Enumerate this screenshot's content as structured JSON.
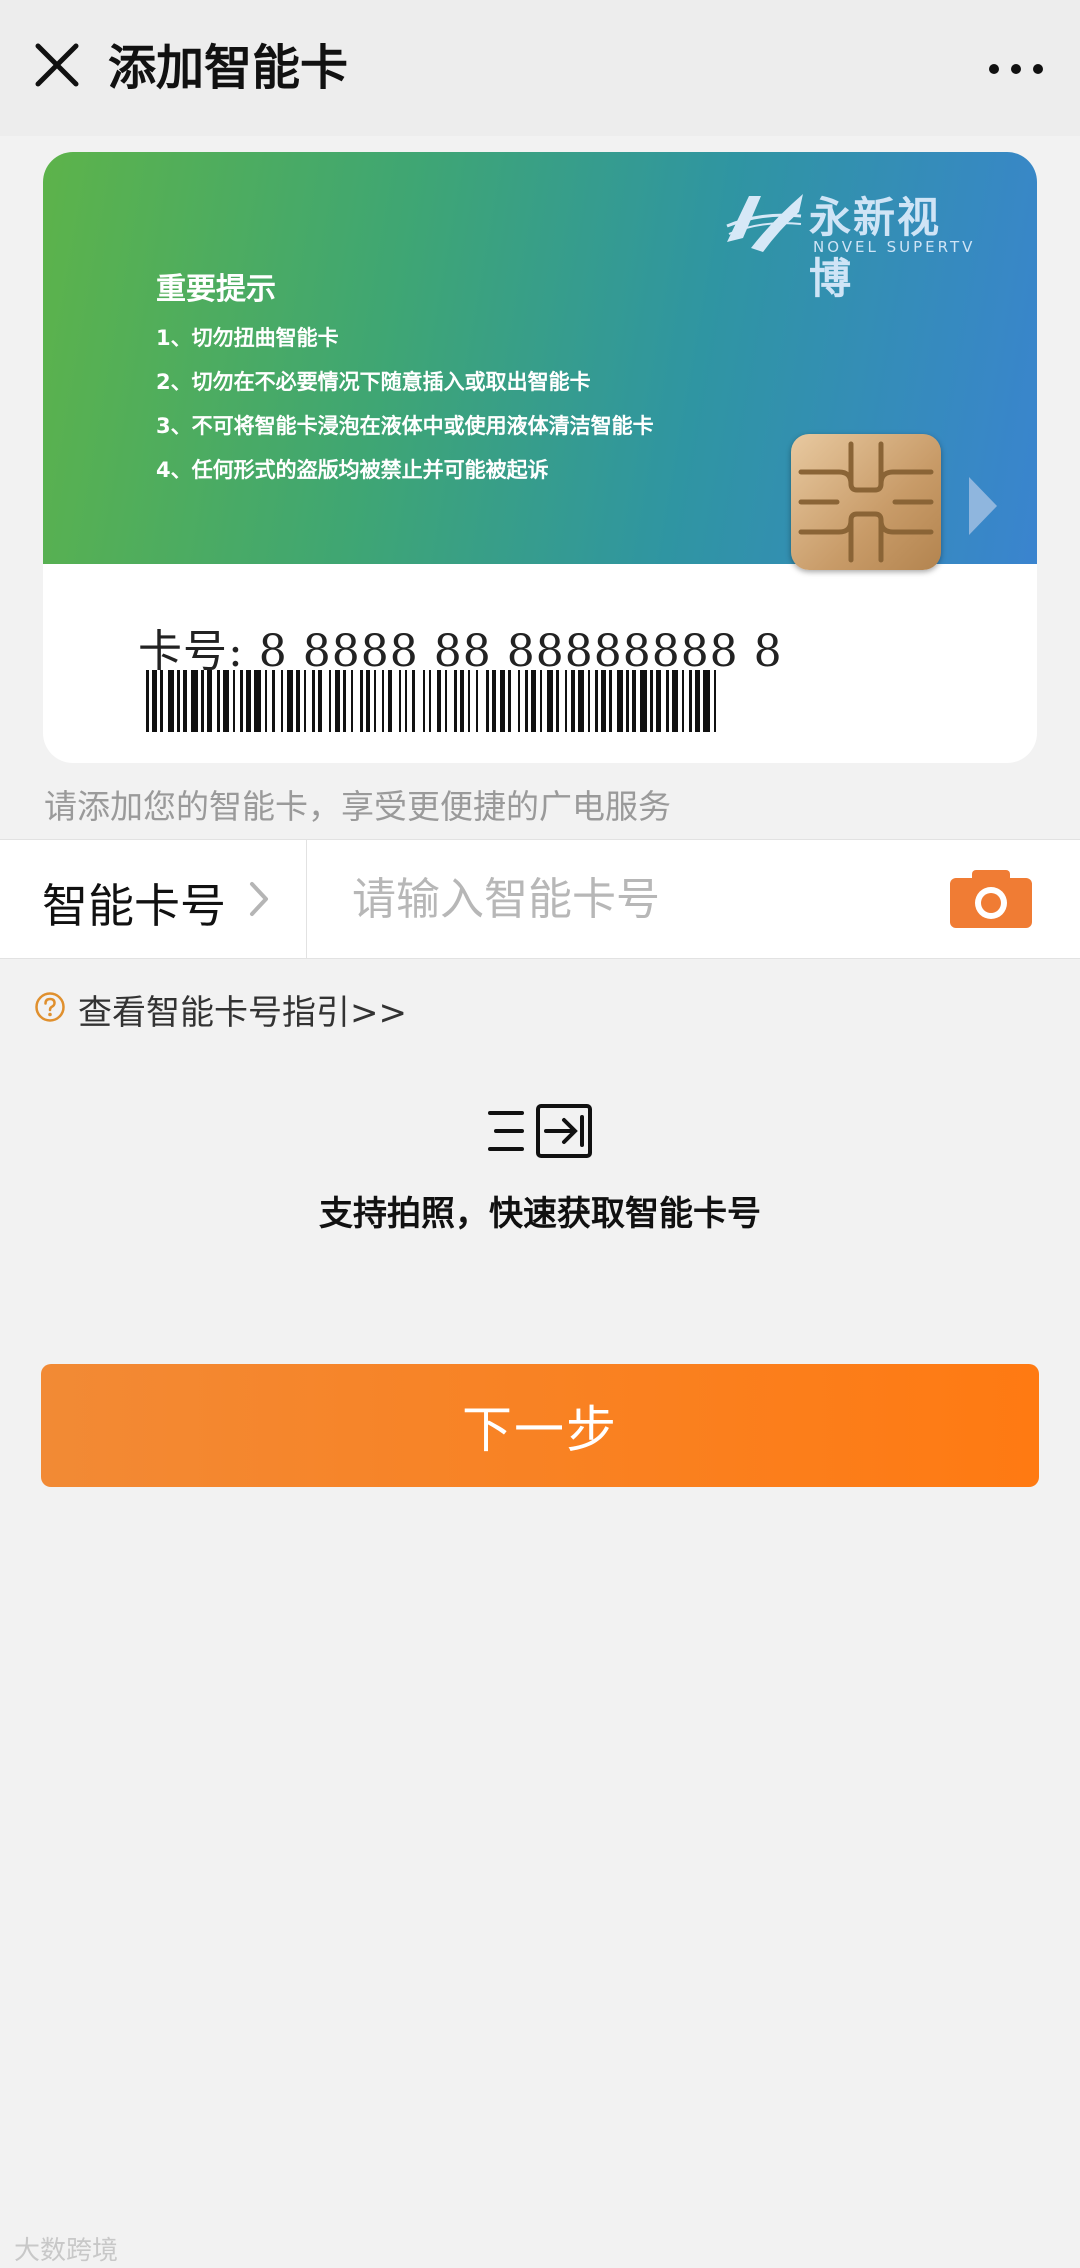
{
  "header": {
    "title": "添加智能卡",
    "close_icon": "close-icon",
    "more_icon": "more-dots-icon"
  },
  "card": {
    "brand_cn": "永新视博",
    "brand_en": "NOVEL SUPERTV",
    "notice_title": "重要提示",
    "notices": [
      "1、切勿扭曲智能卡",
      "2、切勿在不必要情况下随意插入或取出智能卡",
      "3、不可将智能卡浸泡在液体中或使用液体清洁智能卡",
      "4、任何形式的盗版均被禁止并可能被起诉"
    ],
    "number_text": "卡号: 8  8888 88  88888888 8"
  },
  "hint": "请添加您的智能卡，享受更便捷的广电服务",
  "input_row": {
    "label": "智能卡号",
    "placeholder": "请输入智能卡号",
    "value": "",
    "camera_icon": "camera-icon"
  },
  "guide": {
    "text": "查看智能卡号指引>>",
    "icon": "question-circle-icon"
  },
  "scan": {
    "icon": "scan-input-icon",
    "caption": "支持拍照，快速获取智能卡号"
  },
  "next_button": "下一步",
  "watermark": "大数跨境",
  "colors": {
    "accent": "#ff7a12",
    "card_gradient_start": "#5db34a",
    "card_gradient_end": "#3a84cf",
    "background": "#f2f2f2"
  }
}
